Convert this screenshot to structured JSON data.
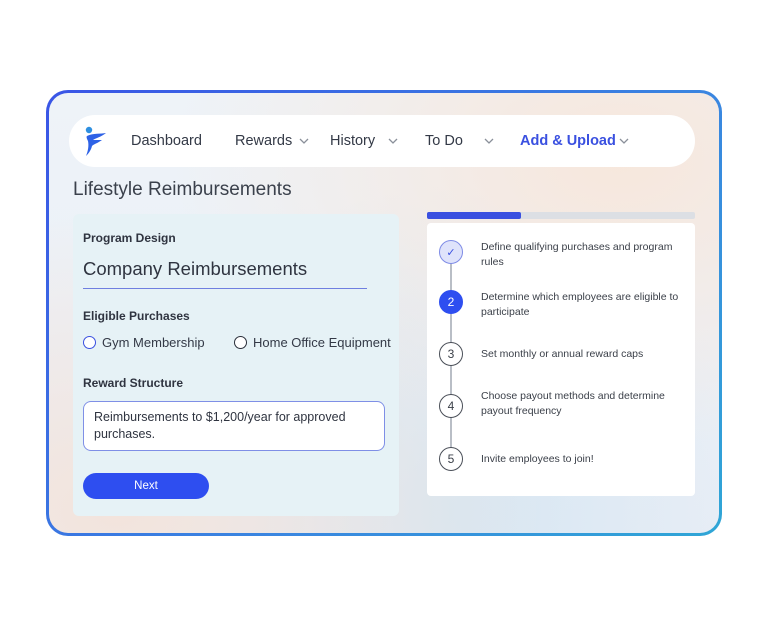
{
  "nav": {
    "items": [
      {
        "label": "Dashboard",
        "has_chevron": false
      },
      {
        "label": "Rewards",
        "has_chevron": true
      },
      {
        "label": "History",
        "has_chevron": true
      },
      {
        "label": "To Do",
        "has_chevron": true
      },
      {
        "label": "Add & Upload",
        "has_chevron": true,
        "active": true
      }
    ]
  },
  "page": {
    "title": "Lifestyle Reimbursements"
  },
  "form": {
    "program_design_label": "Program Design",
    "program_name": "Company Reimbursements",
    "eligible_label": "Eligible Purchases",
    "options": [
      "Gym Membership",
      "Home Office Equipment"
    ],
    "reward_label": "Reward Structure",
    "reward_text": "Reimbursements to $1,200/year for approved purchases.",
    "next_label": "Next"
  },
  "steps": {
    "progress_fraction": 0.35,
    "items": [
      {
        "marker": "✓",
        "state": "done",
        "text": "Define qualifying purchases and program rules"
      },
      {
        "marker": "2",
        "state": "current",
        "text": "Determine which employees are eligible to participate"
      },
      {
        "marker": "3",
        "state": "pending",
        "text": "Set monthly or annual reward caps"
      },
      {
        "marker": "4",
        "state": "pending",
        "text": "Choose payout methods and determine payout frequency"
      },
      {
        "marker": "5",
        "state": "pending",
        "text": "Invite employees to join!"
      }
    ]
  },
  "colors": {
    "accent": "#2e4ef0",
    "frame": "#3a55e6",
    "card": "#e6f2f6"
  },
  "icons": {
    "logo": "person-logo-icon",
    "chevron": "chevron-down-icon",
    "check": "check-icon"
  }
}
